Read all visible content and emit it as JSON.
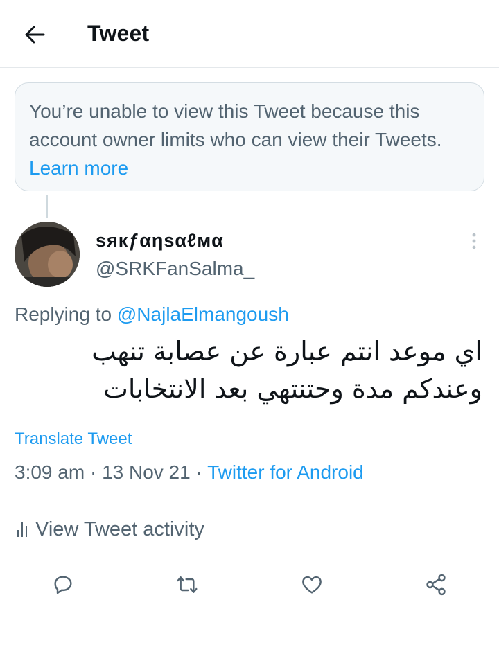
{
  "header": {
    "title": "Tweet"
  },
  "notice": {
    "text": "You’re unable to view this Tweet because this account owner limits who can view their Tweets.",
    "link": "Learn more"
  },
  "tweet": {
    "display_name": "ѕякƒαηѕαℓмα",
    "handle": "@SRKFanSalma_",
    "replying_prefix": "Replying to",
    "replying_to": "@NajlaElmangoush",
    "text": "اي موعد انتم عبارة عن عصابة تنهب وعندكم مدة وحتنتهي بعد الانتخابات",
    "translate_label": "Translate Tweet",
    "time": "3:09 am",
    "date": "13 Nov 21",
    "separator": "·",
    "source": "Twitter for Android"
  },
  "activity": {
    "label": "View Tweet activity"
  },
  "icons": {
    "back": "arrow-left-icon",
    "more": "more-vertical-icon",
    "reply": "reply-icon",
    "retweet": "retweet-icon",
    "like": "heart-icon",
    "share": "share-icon",
    "activity": "bar-chart-icon"
  },
  "colors": {
    "accent": "#1d9bf0",
    "secondary_text": "#536471",
    "primary_text": "#0f1419"
  }
}
